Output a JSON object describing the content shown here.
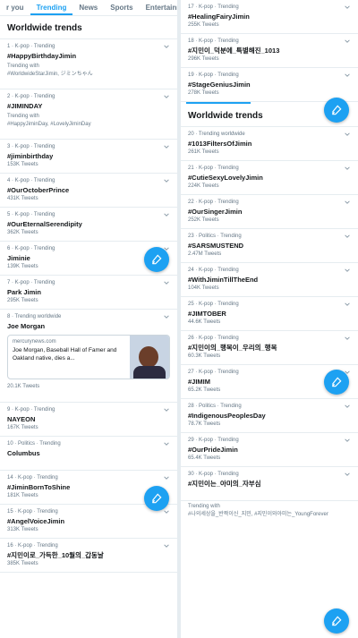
{
  "tabs": [
    "r you",
    "Trending",
    "News",
    "Sports",
    "Entertainme"
  ],
  "left": {
    "heading": "Worldwide trends",
    "trends": [
      {
        "meta": "1 · K-pop · Trending",
        "name": "#HappyBirthdayJimin",
        "count": "",
        "with": "Trending with\n#WorldwideStarJimin, ジミンちゃん"
      },
      {
        "meta": "2 · K-pop · Trending",
        "name": "#JIMINDAY",
        "count": "",
        "with": "Trending with\n#HappyJiminDay, #LovelyJiminDay"
      },
      {
        "meta": "3 · K-pop · Trending",
        "name": "#jiminbirthday",
        "count": "153K Tweets",
        "with": ""
      },
      {
        "meta": "4 · K-pop · Trending",
        "name": "#OurOctoberPrince",
        "count": "431K Tweets",
        "with": ""
      },
      {
        "meta": "5 · K-pop · Trending",
        "name": "#OurEternalSerendipity",
        "count": "362K Tweets",
        "with": ""
      },
      {
        "meta": "6 · K-pop · Trending",
        "name": "Jiminie",
        "count": "139K Tweets",
        "with": ""
      },
      {
        "meta": "7 · K-pop · Trending",
        "name": "Park Jimin",
        "count": "295K Tweets",
        "with": ""
      }
    ],
    "card_trend": {
      "meta": "8 · Trending worldwide",
      "name": "Joe Morgan",
      "card_source": "mercurynews.com",
      "card_title": "Joe Morgan, Baseball Hall of Famer and Oakland native, dies a...",
      "count": "20.1K Tweets"
    },
    "trends2": [
      {
        "meta": "9 · K-pop · Trending",
        "name": "NAYEON",
        "count": "167K Tweets"
      },
      {
        "meta": "10 · Politics · Trending",
        "name": "Columbus",
        "count": ""
      },
      {
        "meta": "14 · K-pop · Trending",
        "name": "#JiminBornToShine",
        "count": "181K Tweets"
      },
      {
        "meta": "15 · K-pop · Trending",
        "name": "#AngelVoiceJimin",
        "count": "313K Tweets"
      },
      {
        "meta": "16 · K-pop · Trending",
        "name": "#지민이로_가득한_10월의_갑동날",
        "count": "385K Tweets"
      }
    ]
  },
  "right": {
    "trends_top": [
      {
        "meta": "17 · K-pop · Trending",
        "name": "#HealingFairyJimin",
        "count": "255K Tweets"
      },
      {
        "meta": "18 · K-pop · Trending",
        "name": "#지민이_덕분에_특별해진_1013",
        "count": "296K Tweets"
      },
      {
        "meta": "19 · K-pop · Trending",
        "name": "#StageGeniusJimin",
        "count": "278K Tweets"
      }
    ],
    "heading": "Worldwide trends",
    "trends": [
      {
        "meta": "20 · Trending worldwide",
        "name": "#1013FiltersOfJimin",
        "count": "261K Tweets"
      },
      {
        "meta": "21 · K-pop · Trending",
        "name": "#CutieSexyLovelyJimin",
        "count": "224K Tweets"
      },
      {
        "meta": "22 · K-pop · Trending",
        "name": "#OurSingerJimin",
        "count": "252K Tweets"
      },
      {
        "meta": "23 · Politics · Trending",
        "name": "#SARSMUSTEND",
        "count": "2.47M Tweets"
      },
      {
        "meta": "24 · K-pop · Trending",
        "name": "#WithJiminTillTheEnd",
        "count": "104K Tweets"
      },
      {
        "meta": "25 · K-pop · Trending",
        "name": "#JIMTOBER",
        "count": "44.6K Tweets"
      },
      {
        "meta": "26 · K-pop · Trending",
        "name": "#지민이의_행복이_우리의_행복",
        "count": "60.3K Tweets"
      },
      {
        "meta": "27 · K-pop · Trending",
        "name": "#JIMIM",
        "count": "65.2K Tweets"
      },
      {
        "meta": "28 · Politics · Trending",
        "name": "#IndigenousPeoplesDay",
        "count": "78.7K Tweets"
      },
      {
        "meta": "29 · K-pop · Trending",
        "name": "#OurPrideJimin",
        "count": "65.4K Tweets"
      },
      {
        "meta": "30 · K-pop · Trending",
        "name": "#지민이는_아미의_자부심",
        "count": ""
      }
    ],
    "last_with": "Trending with\n#나의세상을_반짝이신_지민, #지민이와아미는_YoungForever"
  },
  "colors": {
    "accent": "#1da1f2",
    "text": "#14171a",
    "muted": "#657786"
  },
  "icons": {
    "chevron": "chevron-down-icon",
    "compose": "compose-tweet-icon"
  }
}
